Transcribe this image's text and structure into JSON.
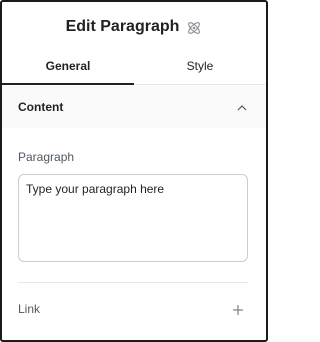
{
  "header": {
    "title": "Edit Paragraph",
    "icon": "atom-icon"
  },
  "tabs": [
    {
      "label": "General",
      "active": true
    },
    {
      "label": "Style",
      "active": false
    }
  ],
  "section": {
    "title": "Content",
    "expanded": true
  },
  "paragraph": {
    "label": "Paragraph",
    "placeholder": "Type your paragraph here",
    "value": ""
  },
  "link": {
    "label": "Link",
    "icon": "plus-icon"
  },
  "colors": {
    "text": "#1f2124",
    "muted": "#515962",
    "border": "#c9ccd0",
    "divider": "#e6e8ea"
  }
}
